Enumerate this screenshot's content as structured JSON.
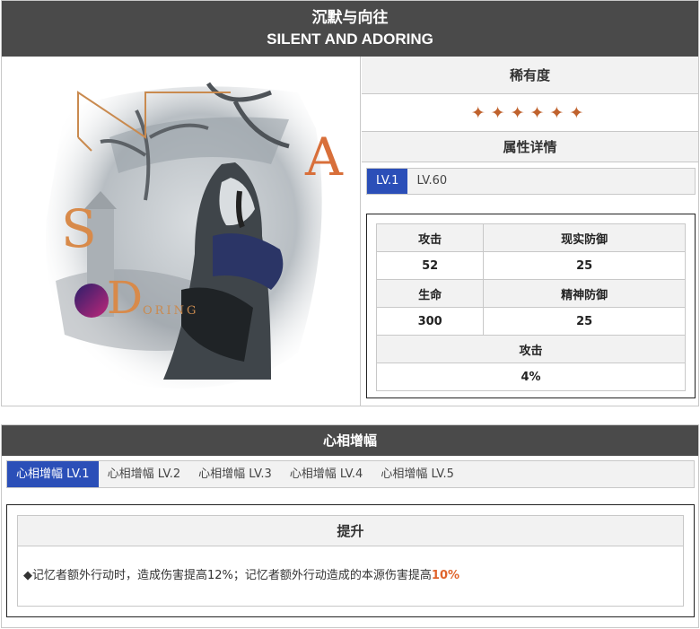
{
  "header": {
    "title_cn": "沉默与向往",
    "title_en": "SILENT AND ADORING"
  },
  "art": {
    "letter_s": "S",
    "letter_a": "A",
    "letter_d": "D",
    "word_doring": "ORING"
  },
  "rarity": {
    "label": "稀有度",
    "stars": "✦✦✦✦✦✦",
    "color": "#c0622d"
  },
  "attributes": {
    "label": "属性详情",
    "levels": [
      "LV.1",
      "LV.60"
    ],
    "active_level": "LV.1",
    "stats": {
      "attack_label": "攻击",
      "attack_value": "52",
      "real_def_label": "现实防御",
      "real_def_value": "25",
      "hp_label": "生命",
      "hp_value": "300",
      "mental_def_label": "精神防御",
      "mental_def_value": "25",
      "bonus_label": "攻击",
      "bonus_value": "4%"
    }
  },
  "amplification": {
    "title": "心相增幅",
    "tabs": [
      "心相增幅 LV.1",
      "心相增幅 LV.2",
      "心相增幅 LV.3",
      "心相增幅 LV.4",
      "心相增幅 LV.5"
    ],
    "active_tab": "心相增幅 LV.1",
    "section_label": "提升",
    "description": "◆记忆者额外行动时，造成伤害提高12%；记忆者额外行动造成的本源伤害提高",
    "description_highlight": "10%",
    "highlight_color": "#e0642c",
    "active_color": "#2b4fb8"
  }
}
